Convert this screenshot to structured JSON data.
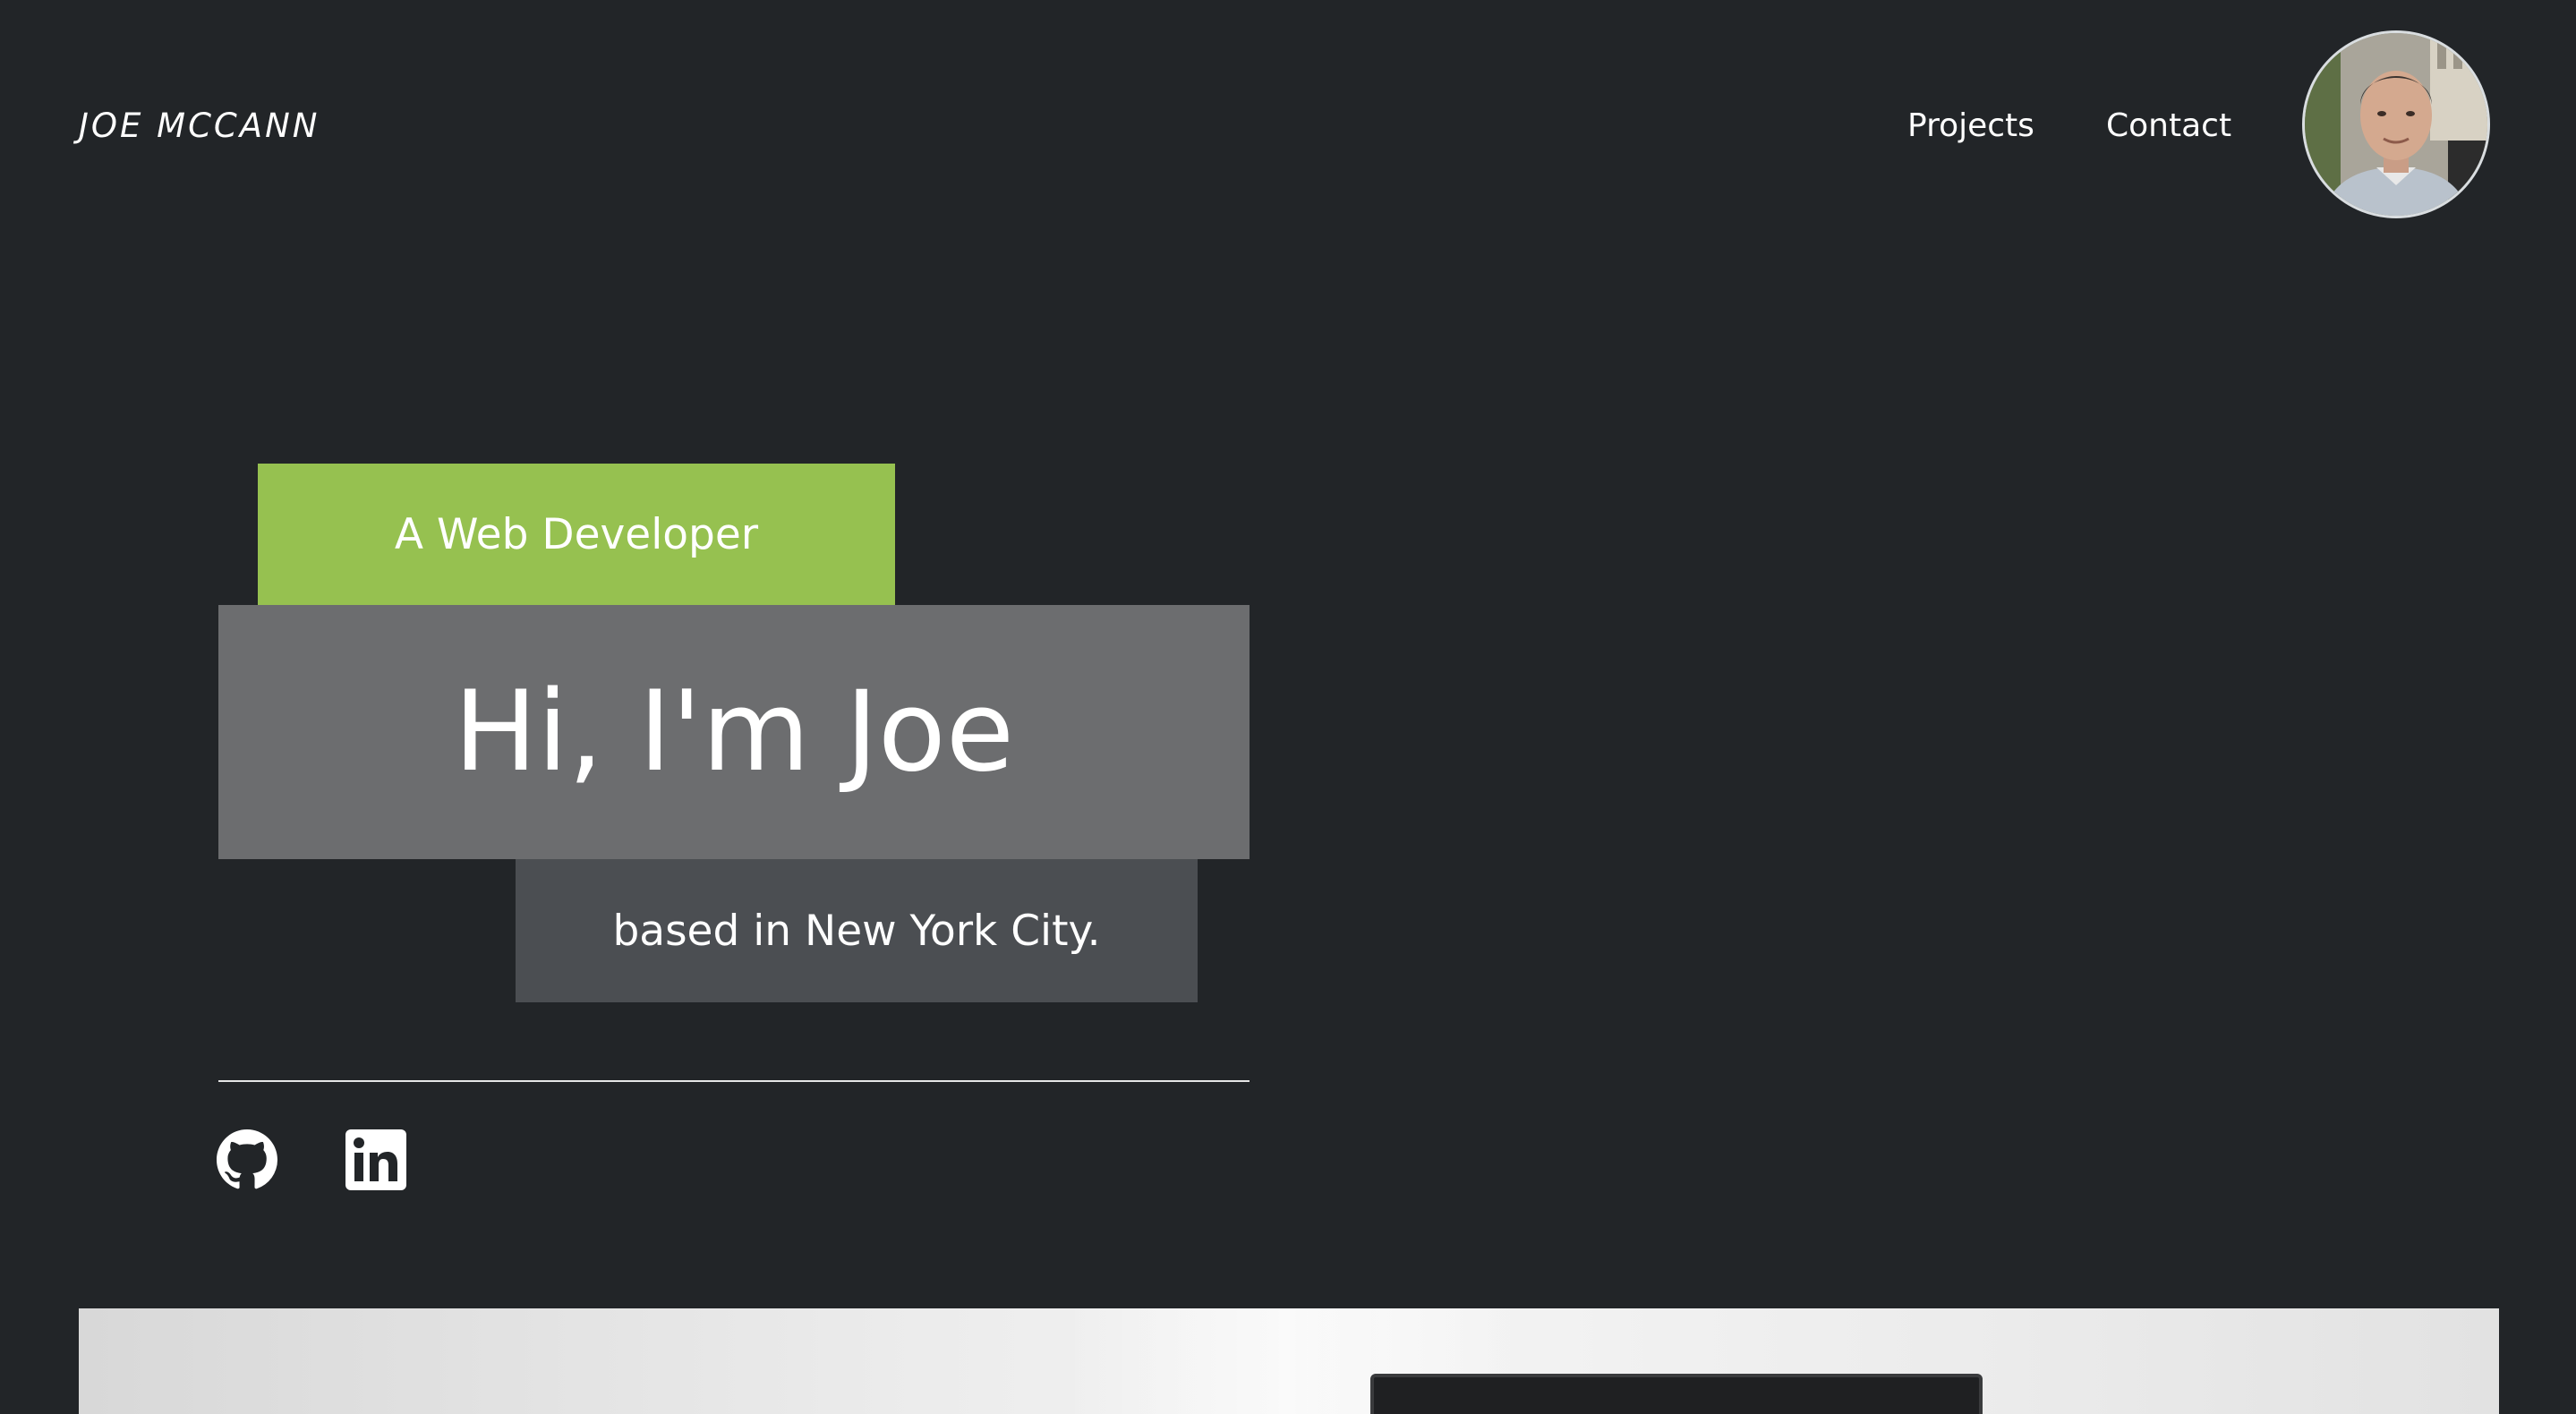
{
  "header": {
    "brand": "JOE MCCANN",
    "nav": [
      {
        "label": "Projects"
      },
      {
        "label": "Contact"
      }
    ],
    "avatar_alt": "Joe McCann portrait"
  },
  "hero": {
    "tagline": "A Web Developer",
    "heading": "Hi, I'm Joe",
    "location": "based in New York City."
  },
  "social": [
    {
      "icon": "github-icon"
    },
    {
      "icon": "linkedin-icon"
    }
  ],
  "colors": {
    "background": "#222528",
    "accent_green": "#96c150",
    "hero_gray": "#6c6d6f",
    "location_gray": "#4b4e52"
  }
}
